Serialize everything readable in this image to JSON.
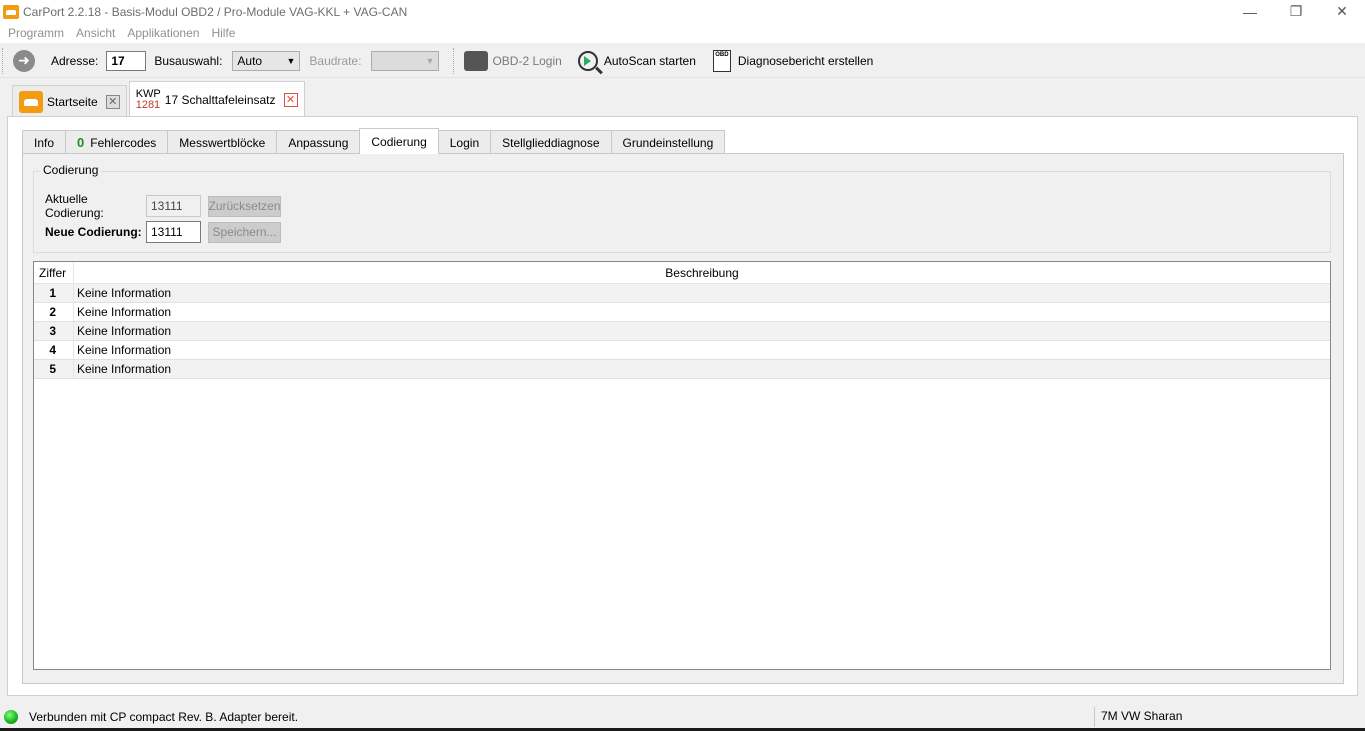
{
  "window": {
    "title": "CarPort 2.2.18  - Basis-Modul OBD2 / Pro-Module VAG-KKL + VAG-CAN",
    "minimize": "—",
    "maximize": "❐",
    "close": "✕"
  },
  "menu": [
    "Programm",
    "Ansicht",
    "Applikationen",
    "Hilfe"
  ],
  "toolbar": {
    "address_label": "Adresse:",
    "address_value": "17",
    "bus_label": "Busauswahl:",
    "bus_value": "Auto",
    "baud_label": "Baudrate:",
    "baud_value": "",
    "obd_login": "OBD-2 Login",
    "autoscan": "AutoScan starten",
    "report": "Diagnosebericht erstellen",
    "report_icon_text": "OBD"
  },
  "module_tabs": {
    "home": "Startseite",
    "module_protocol": "KWP",
    "module_number": "1281",
    "module_name": "17 Schalttafeleinsatz"
  },
  "subtabs": {
    "info": "Info",
    "fault_count": "0",
    "faults": "Fehlercodes",
    "blocks": "Messwertblöcke",
    "adapt": "Anpassung",
    "coding": "Codierung",
    "login": "Login",
    "actuator": "Stellglieddiagnose",
    "basic": "Grundeinstellung"
  },
  "coding": {
    "group_title": "Codierung",
    "current_label": "Aktuelle Codierung:",
    "current_value": "13111",
    "reset_button": "Zurücksetzen",
    "new_label": "Neue Codierung:",
    "new_value": "13111",
    "save_button": "Speichern..."
  },
  "table": {
    "col_digit": "Ziffer",
    "col_desc": "Beschreibung",
    "rows": [
      {
        "digit": "1",
        "desc": "Keine Information"
      },
      {
        "digit": "2",
        "desc": "Keine Information"
      },
      {
        "digit": "3",
        "desc": "Keine Information"
      },
      {
        "digit": "4",
        "desc": "Keine Information"
      },
      {
        "digit": "5",
        "desc": "Keine Information"
      }
    ]
  },
  "status": {
    "connection": "Verbunden mit CP compact Rev. B. Adapter bereit.",
    "vehicle": "7M VW Sharan",
    "led_color": "#17b317"
  }
}
